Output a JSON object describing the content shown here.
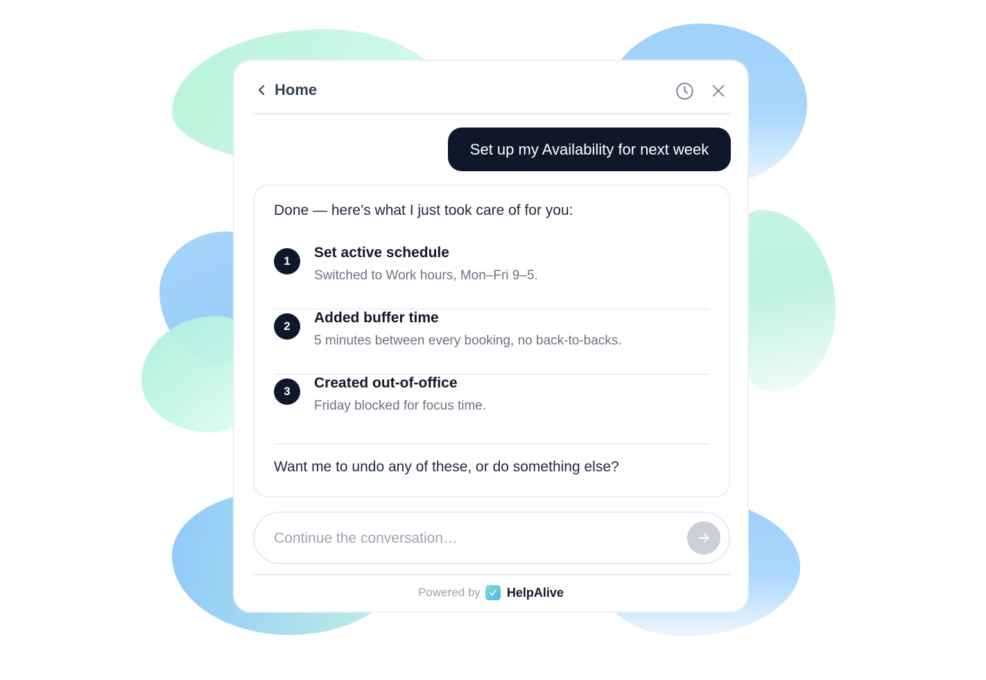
{
  "header": {
    "back_icon": "chevron-left-icon",
    "title": "Home",
    "history_icon": "clock-icon",
    "close_icon": "close-icon"
  },
  "conversation": {
    "user_message": "Set up my Availability for next week",
    "assistant": {
      "intro": "Done — here’s what I just took care of for you:",
      "steps": [
        {
          "number": "1",
          "title": "Set active schedule",
          "description": "Switched to Work hours, Mon–Fri 9–5."
        },
        {
          "number": "2",
          "title": "Added buffer time",
          "description": "5 minutes between every booking, no back-to-backs."
        },
        {
          "number": "3",
          "title": "Created out-of-office",
          "description": "Friday blocked for focus time."
        }
      ],
      "outro": "Want me to undo any of these, or do something else?"
    }
  },
  "composer": {
    "placeholder": "Continue the conversation…",
    "value": "",
    "send_icon": "arrow-right-icon"
  },
  "footer": {
    "powered_by": "Powered by",
    "brand": "HelpAlive",
    "brand_icon": "checkmark-icon"
  },
  "colors": {
    "primary_dark": "#0f172a",
    "muted_text": "#6b7280",
    "send_button_disabled": "#cbd0d8"
  }
}
